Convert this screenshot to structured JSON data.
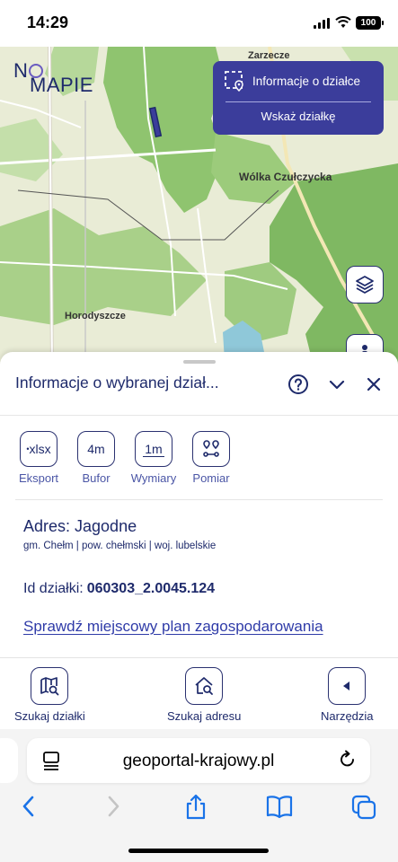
{
  "status_bar": {
    "time": "14:29",
    "battery": "100"
  },
  "map": {
    "logo_line1": "N",
    "logo_line2": "MAPIE",
    "labels": {
      "top": "Zarzecze",
      "right": "Wólka Czułczycka",
      "left": "Horodyszcze"
    },
    "info_panel": {
      "title": "Informacje o działce",
      "action": "Wskaż działkę"
    }
  },
  "sheet": {
    "title": "Informacje o wybranej dział...",
    "tools": [
      {
        "icon_text": "xlsx",
        "label": "Eksport"
      },
      {
        "icon_text": "4m",
        "label": "Bufor"
      },
      {
        "icon_text": "1m",
        "label": "Wymiary"
      },
      {
        "icon_text": "",
        "label": "Pomiar"
      }
    ],
    "address_label": "Adres: Jagodne",
    "address_sub": "gm. Chełm | pow. chełmski | woj. lubelskie",
    "id_label": "Id działki:",
    "id_value": "060303_2.0045.124",
    "plan_link": "Sprawdź miejscowy plan zagospodarowania"
  },
  "bottom_tools": {
    "search_parcel": "Szukaj działki",
    "search_address": "Szukaj adresu",
    "tools": "Narzędzia"
  },
  "browser": {
    "url": "geoportal-krajowy.pl"
  },
  "colors": {
    "primary": "#1e2a6b",
    "panel": "#3b3d9b",
    "map_green": "#8fc46f",
    "map_base": "#e9ecd6"
  }
}
